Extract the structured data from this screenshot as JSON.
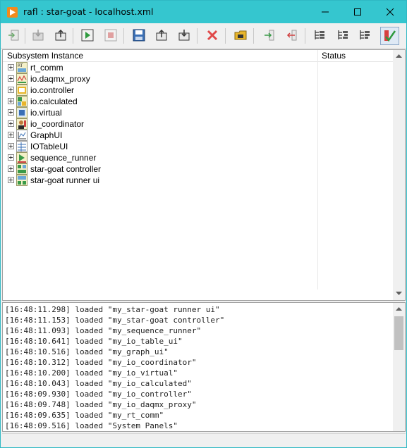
{
  "window": {
    "title": "rafl : star-goat - localhost.xml"
  },
  "tree": {
    "columns": [
      "Subsystem Instance",
      "Status"
    ],
    "rows": [
      {
        "label": "rt_comm",
        "icon": "rt-comm-icon"
      },
      {
        "label": "io.daqmx_proxy",
        "icon": "daqmx-proxy-icon"
      },
      {
        "label": "io.controller",
        "icon": "io-controller-icon"
      },
      {
        "label": "io.calculated",
        "icon": "io-calculated-icon"
      },
      {
        "label": "io.virtual",
        "icon": "io-virtual-icon"
      },
      {
        "label": "io_coordinator",
        "icon": "io-coordinator-icon"
      },
      {
        "label": "GraphUI",
        "icon": "graph-ui-icon"
      },
      {
        "label": "IOTableUI",
        "icon": "io-table-ui-icon"
      },
      {
        "label": "sequence_runner",
        "icon": "sequence-runner-icon"
      },
      {
        "label": "star-goat controller",
        "icon": "controller-icon"
      },
      {
        "label": "star-goat runner ui",
        "icon": "runner-ui-icon"
      }
    ]
  },
  "log": [
    "[16:48:11.298] loaded \"my_star-goat runner ui\"",
    "[16:48:11.153] loaded \"my_star-goat controller\"",
    "[16:48:11.093] loaded \"my_sequence_runner\"",
    "[16:48:10.641] loaded \"my_io_table_ui\"",
    "[16:48:10.516] loaded \"my_graph_ui\"",
    "[16:48:10.312] loaded \"my_io_coordinator\"",
    "[16:48:10.200] loaded \"my_io_virtual\"",
    "[16:48:10.043] loaded \"my_io_calculated\"",
    "[16:48:09.930] loaded \"my_io_controller\"",
    "[16:48:09.748] loaded \"my_io_daqmx_proxy\"",
    "[16:48:09.635] loaded \"my_rt_comm\"",
    "[16:48:09.516] loaded \"System Panels\""
  ],
  "status": {
    "text": ""
  },
  "colors": {
    "titlebar": "#35c6cf",
    "accent_orange": "#f28a1c"
  }
}
